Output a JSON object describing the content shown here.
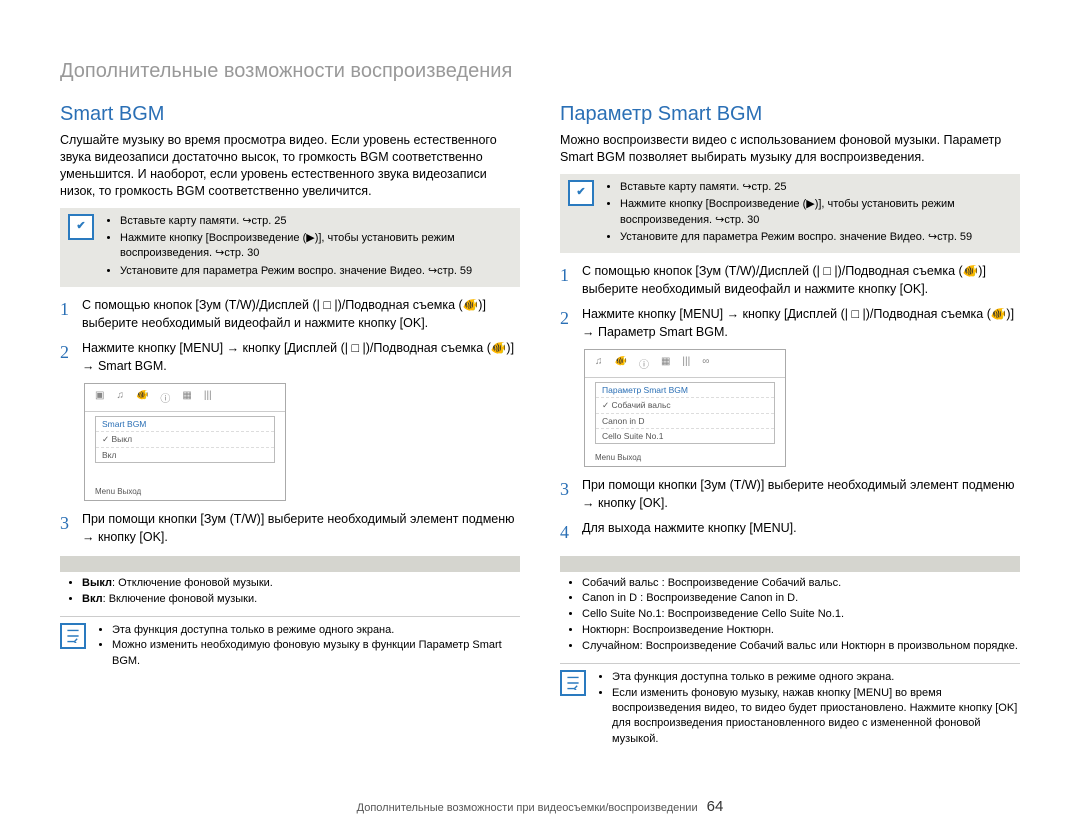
{
  "page_title": "Дополнительные возможности воспроизведения",
  "footer_text": "Дополнительные возможности при видеосъемки/воспроизведении",
  "page_number": "64",
  "left": {
    "title": "Smart BGM",
    "intro": "Слушайте музыку во время просмотра видео. Если уровень естественного звука видеозаписи достаточно высок, то громкость BGM соответственно уменьшится. И наоборот, если уровень естественного звука видеозаписи низок, то громкость BGM соответственно увеличится.",
    "info_items": [
      "Вставьте карту памяти. ↪стр. 25",
      "Нажмите кнопку [Воспроизведение (▶)], чтобы установить режим воспроизведения. ↪стр. 30",
      "Установите для параметра Режим воспро. значение Видео. ↪стр. 59"
    ],
    "steps": {
      "s1": "С помощью кнопок [Зум (T/W)/Дисплей (| □ |)/Подводная съемка (🐠)] выберите необходимый видеофайл и нажмите кнопку [OK].",
      "s2": "Нажмите кнопку [MENU] → кнопку [Дисплей (| □ |)/Подводная съемка (🐠)] → Smart BGM.",
      "s3": "При помощи кнопки [Зум (T/W)] выберите необходимый элемент подменю → кнопку [OK]."
    },
    "screenshot": {
      "menu_head": "Smart BGM",
      "item_off": "✓ Выкл",
      "item_on": "   Вкл",
      "exit": "Menu Выход"
    },
    "submenu_items": [
      "Выкл: Отключение фоновой музыки.",
      "Вкл: Включение фоновой музыки."
    ],
    "note_items": [
      "Эта функция доступна только в режиме одного экрана.",
      "Можно изменить необходимую фоновую музыку в функции Параметр Smart BGM."
    ]
  },
  "right": {
    "title": "Параметр Smart BGM",
    "intro": "Можно воспроизвести видео с использованием фоновой музыки. Параметр Smart BGM позволяет выбирать музыку для воспроизведения.",
    "info_items": [
      "Вставьте карту памяти. ↪стр. 25",
      "Нажмите кнопку [Воспроизведение (▶)], чтобы установить режим воспроизведения. ↪стр. 30",
      "Установите для параметра Режим воспро. значение Видео. ↪стр. 59"
    ],
    "steps": {
      "s1": "С помощью кнопок [Зум (T/W)/Дисплей (| □ |)/Подводная съемка (🐠)] выберите необходимый видеофайл и нажмите кнопку [OK].",
      "s2": "Нажмите кнопку [MENU] → кнопку [Дисплей (| □ |)/Подводная съемка (🐠)] → Параметр Smart BGM.",
      "s3": "При помощи кнопки [Зум (T/W)] выберите необходимый элемент подменю → кнопку [OK].",
      "s4": "Для выхода нажмите кнопку [MENU]."
    },
    "screenshot": {
      "menu_head": "Параметр Smart BGM",
      "items": [
        "✓ Собачий вальс",
        "  Canon in D",
        "  Cello Suite No.1"
      ],
      "exit": "Menu Выход"
    },
    "submenu_items": [
      "Собачий вальс : Воспроизведение Собачий вальс.",
      "Canon in D : Воспроизведение Canon in D.",
      "Cello Suite No.1: Воспроизведение Cello Suite No.1.",
      "Ноктюрн: Воспроизведение Ноктюрн.",
      "Случайном: Воспроизведение Собачий вальс или Ноктюрн в произвольном порядке."
    ],
    "note_items": [
      "Эта функция доступна только в режиме одного экрана.",
      "Если изменить фоновую музыку, нажав кнопку [MENU] во время воспроизведения видео, то видео будет приостановлено. Нажмите кнопку [OK] для воспроизведения приостановленного видео с измененной фоновой музыкой."
    ]
  }
}
